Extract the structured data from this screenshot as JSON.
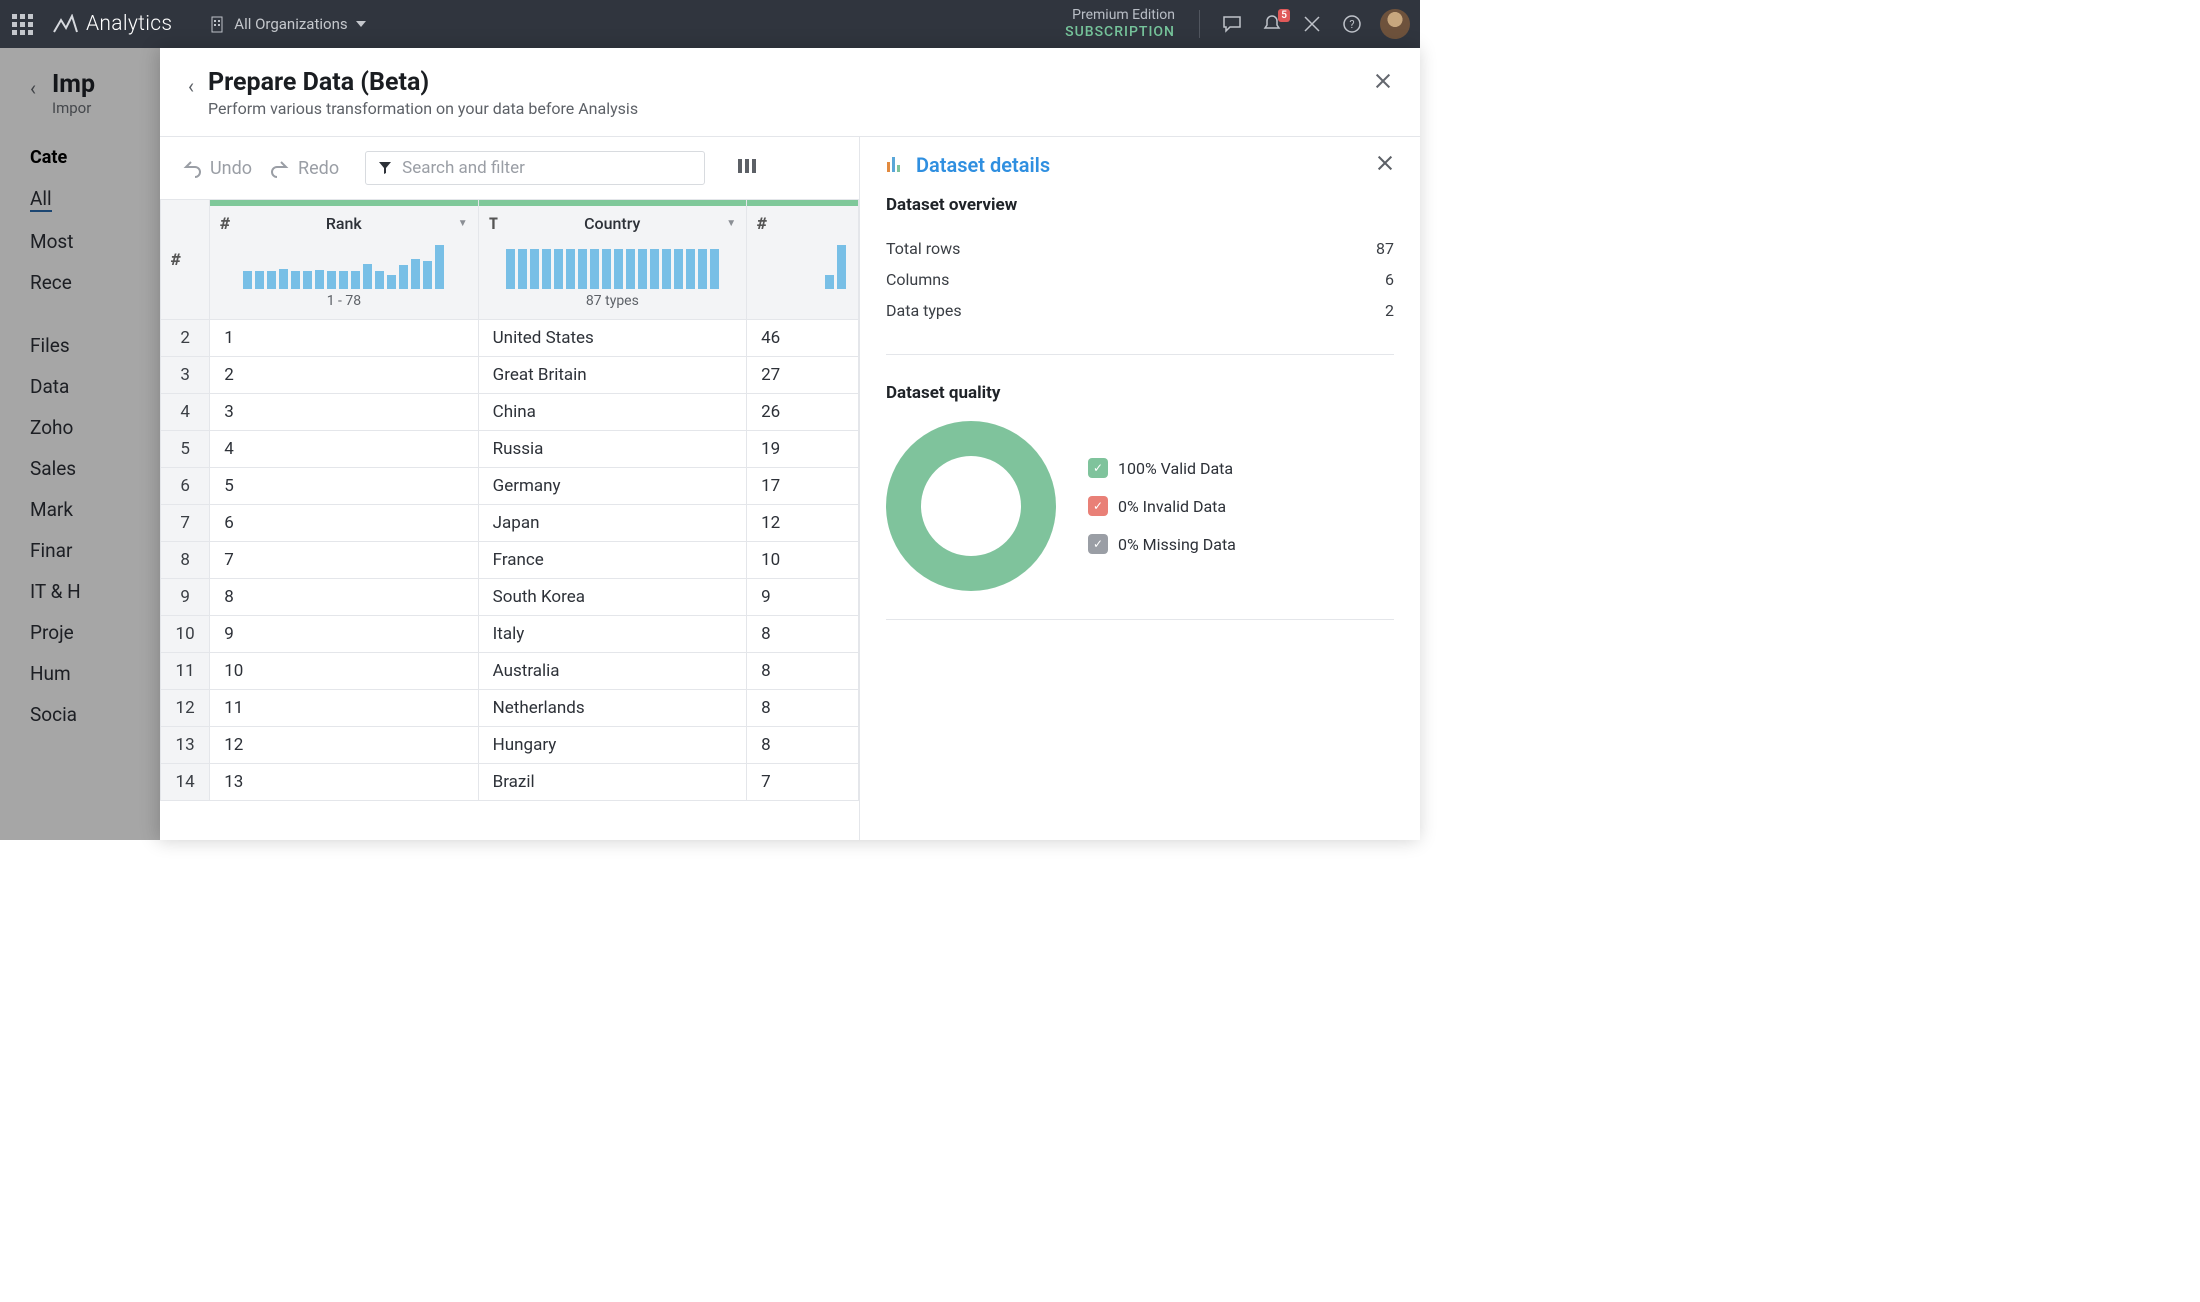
{
  "topbar": {
    "app_name": "Analytics",
    "org_label": "All Organizations",
    "edition_top": "Premium Edition",
    "edition_bottom": "SUBSCRIPTION",
    "notification_count": "5"
  },
  "behind": {
    "title": "Imp",
    "subtitle": "Impor",
    "category_header": "Cate",
    "categories": [
      "All",
      "Most",
      "Rece",
      "Files",
      "Data",
      "Zoho",
      "Sales",
      "Mark",
      "Finar",
      "IT & H",
      "Proje",
      "Hum",
      "Socia"
    ]
  },
  "modal": {
    "title": "Prepare Data (Beta)",
    "subtitle": "Perform various transformation on your data before Analysis",
    "undo": "Undo",
    "redo": "Redo",
    "search_placeholder": "Search and filter"
  },
  "columns": {
    "rownum": "#",
    "rank_type": "#",
    "rank_label": "Rank",
    "rank_caption": "1 - 78",
    "country_type": "T",
    "country_label": "Country",
    "country_caption": "87 types",
    "col3_type": "#"
  },
  "rank_hist": [
    18,
    18,
    18,
    20,
    18,
    18,
    19,
    18,
    18,
    18,
    25,
    18,
    14,
    24,
    30,
    28,
    44
  ],
  "country_hist": [
    40,
    40,
    40,
    40,
    40,
    40,
    40,
    40,
    40,
    40,
    40,
    40,
    40,
    40,
    40,
    40,
    40,
    40
  ],
  "col3_hist": [
    14,
    44
  ],
  "rows": [
    {
      "n": "2",
      "rank": "1",
      "country": "United States",
      "v": "46"
    },
    {
      "n": "3",
      "rank": "2",
      "country": "Great Britain",
      "v": "27"
    },
    {
      "n": "4",
      "rank": "3",
      "country": "China",
      "v": "26"
    },
    {
      "n": "5",
      "rank": "4",
      "country": "Russia",
      "v": "19"
    },
    {
      "n": "6",
      "rank": "5",
      "country": "Germany",
      "v": "17"
    },
    {
      "n": "7",
      "rank": "6",
      "country": "Japan",
      "v": "12"
    },
    {
      "n": "8",
      "rank": "7",
      "country": "France",
      "v": "10"
    },
    {
      "n": "9",
      "rank": "8",
      "country": "South Korea",
      "v": "9"
    },
    {
      "n": "10",
      "rank": "9",
      "country": "Italy",
      "v": "8"
    },
    {
      "n": "11",
      "rank": "10",
      "country": "Australia",
      "v": "8"
    },
    {
      "n": "12",
      "rank": "11",
      "country": "Netherlands",
      "v": "8"
    },
    {
      "n": "13",
      "rank": "12",
      "country": "Hungary",
      "v": "8"
    },
    {
      "n": "14",
      "rank": "13",
      "country": "Brazil",
      "v": "7"
    }
  ],
  "details": {
    "title": "Dataset details",
    "overview_header": "Dataset overview",
    "total_rows_label": "Total rows",
    "total_rows_value": "87",
    "columns_label": "Columns",
    "columns_value": "6",
    "data_types_label": "Data types",
    "data_types_value": "2",
    "quality_header": "Dataset quality",
    "valid": "100% Valid Data",
    "invalid": "0% Invalid Data",
    "missing": "0% Missing Data"
  },
  "chart_data": {
    "type": "pie",
    "title": "Dataset quality",
    "series": [
      {
        "name": "Valid Data",
        "value": 100
      },
      {
        "name": "Invalid Data",
        "value": 0
      },
      {
        "name": "Missing Data",
        "value": 0
      }
    ]
  }
}
